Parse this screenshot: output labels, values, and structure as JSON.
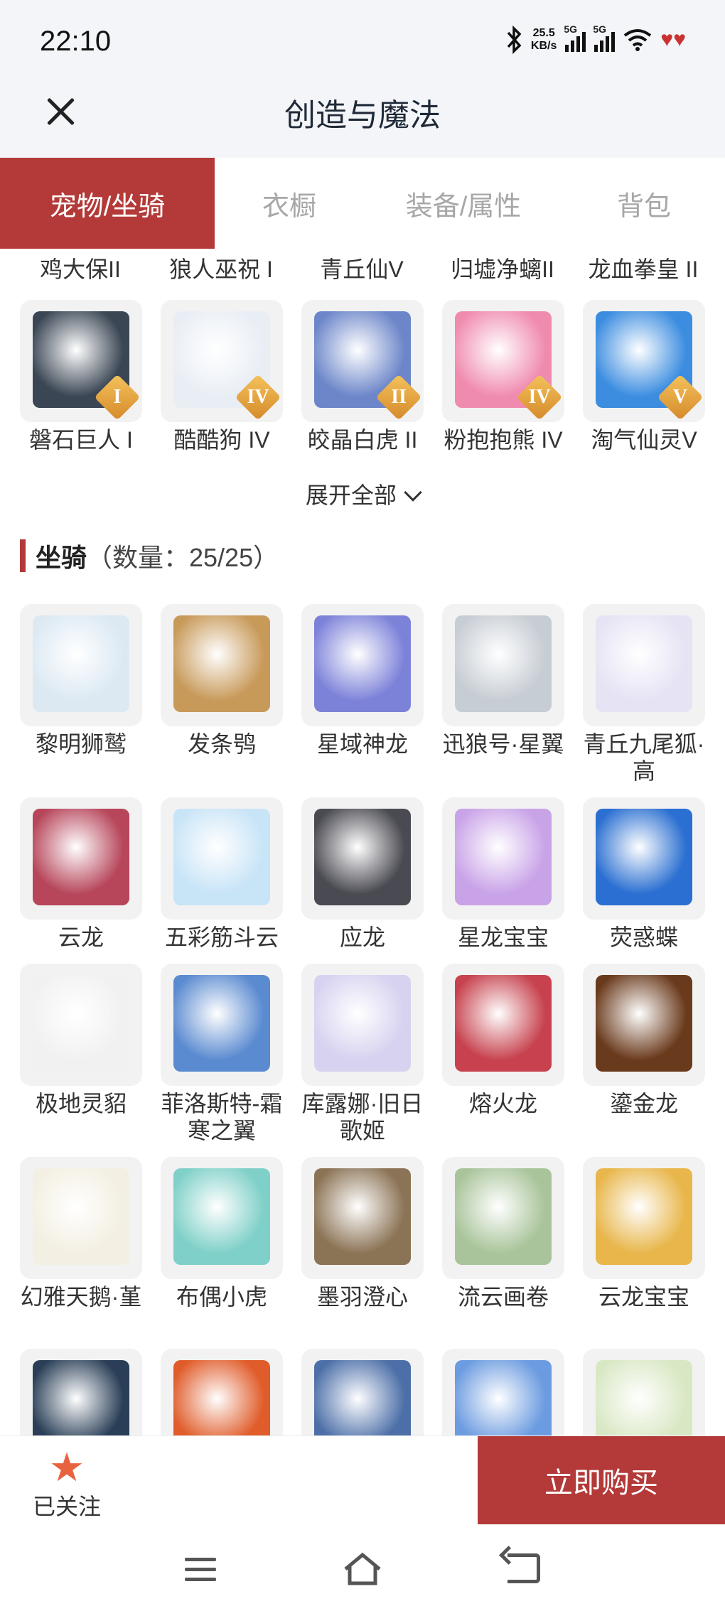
{
  "status": {
    "time": "22:10",
    "speed_value": "25.5",
    "speed_unit": "KB/s",
    "net1": "5G",
    "net2": "5G"
  },
  "header": {
    "title": "创造与魔法"
  },
  "tabs": [
    "宠物/坐骑",
    "衣橱",
    "装备/属性",
    "背包"
  ],
  "pets_top_row": [
    "鸡大保II",
    "狼人巫祝 I",
    "青丘仙V",
    "归墟净螭II",
    "龙血拳皇 II"
  ],
  "pets": [
    {
      "name": "磐石巨人 I",
      "rank": "I",
      "color": "#3a4654"
    },
    {
      "name": "酷酷狗 IV",
      "rank": "IV",
      "color": "#e9eef5"
    },
    {
      "name": "皎晶白虎 II",
      "rank": "II",
      "color": "#6c86c9"
    },
    {
      "name": "粉抱抱熊 IV",
      "rank": "IV",
      "color": "#f08bb0"
    },
    {
      "name": "淘气仙灵V",
      "rank": "V",
      "color": "#3c8de0"
    }
  ],
  "expand_label": "展开全部",
  "mounts_section": {
    "title": "坐骑",
    "count": "（数量：25/25）"
  },
  "mounts": [
    {
      "name": "黎明狮鹫",
      "color": "#dce9f3"
    },
    {
      "name": "发条鸮",
      "color": "#c89a5a"
    },
    {
      "name": "星域神龙",
      "color": "#7d82d9"
    },
    {
      "name": "迅狼号·星翼",
      "color": "#c7cdd4"
    },
    {
      "name": "青丘九尾狐·高",
      "color": "#e6e3f4"
    },
    {
      "name": "云龙",
      "color": "#b7465b"
    },
    {
      "name": "五彩筋斗云",
      "color": "#c8e4f7"
    },
    {
      "name": "应龙",
      "color": "#4a4a52"
    },
    {
      "name": "星龙宝宝",
      "color": "#c9a3e8"
    },
    {
      "name": "荧惑蝶",
      "color": "#2a6fd1"
    },
    {
      "name": "极地灵貂",
      "color": "#f1f1f1"
    },
    {
      "name": "菲洛斯特-霜寒之翼",
      "color": "#5a8ad0"
    },
    {
      "name": "库露娜·旧日歌姬",
      "color": "#d6d2f0"
    },
    {
      "name": "熔火龙",
      "color": "#c7424e"
    },
    {
      "name": "鎏金龙",
      "color": "#6a3a1c"
    },
    {
      "name": "幻雅天鹅·堇",
      "color": "#f3efe2"
    },
    {
      "name": "布偶小虎",
      "color": "#7fd0c8"
    },
    {
      "name": "墨羽澄心",
      "color": "#8b7355"
    },
    {
      "name": "流云画卷",
      "color": "#a9c49a"
    },
    {
      "name": "云龙宝宝",
      "color": "#e8b64a"
    },
    {
      "name": "",
      "color": "#2a3f57"
    },
    {
      "name": "",
      "color": "#e05c2a"
    },
    {
      "name": "",
      "color": "#4c6fa8"
    },
    {
      "name": "",
      "color": "#6b9be0"
    },
    {
      "name": "",
      "color": "#d9e8c4"
    }
  ],
  "bottom": {
    "follow_label": "已关注",
    "buy_label": "立即购买"
  }
}
